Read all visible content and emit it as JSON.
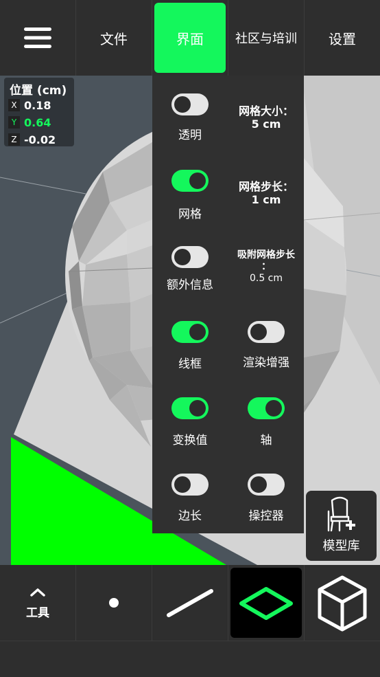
{
  "top_menu": {
    "file": "文件",
    "view": "界面",
    "community": "社区与培训",
    "settings": "设置",
    "active_color": "#14f75c"
  },
  "position": {
    "title": "位置 (cm)",
    "x_label": "X",
    "x_value": "0.18",
    "y_label": "Y",
    "y_value": "0.64",
    "z_label": "Z",
    "z_value": "-0.02"
  },
  "view_menu": {
    "transparent": {
      "label": "透明",
      "on": false
    },
    "grid_size": {
      "label": "网格大小：",
      "value": "5 cm"
    },
    "grid": {
      "label": "网格",
      "on": true
    },
    "grid_step": {
      "label": "网格步长：",
      "value": "1 cm"
    },
    "extra_info": {
      "label": "额外信息",
      "on": false
    },
    "snap_step": {
      "label_line1": "吸附网格步长",
      "label_line2": "：",
      "value": "0.5 cm"
    },
    "wireframe": {
      "label": "线框",
      "on": true
    },
    "render_enhance": {
      "label": "渲染增强",
      "on": false
    },
    "transform_values": {
      "label": "变换值",
      "on": true
    },
    "axis": {
      "label": "轴",
      "on": true
    },
    "edge_length": {
      "label": "边长",
      "on": false
    },
    "manipulator": {
      "label": "操控器",
      "on": false
    }
  },
  "model_library": {
    "label": "模型库"
  },
  "toolbar": {
    "tools_label": "工具",
    "icons": [
      "menu-icon",
      "chevron-up-icon",
      "point-icon",
      "line-icon",
      "plane-icon",
      "cube-icon",
      "chair-plus-icon"
    ]
  }
}
